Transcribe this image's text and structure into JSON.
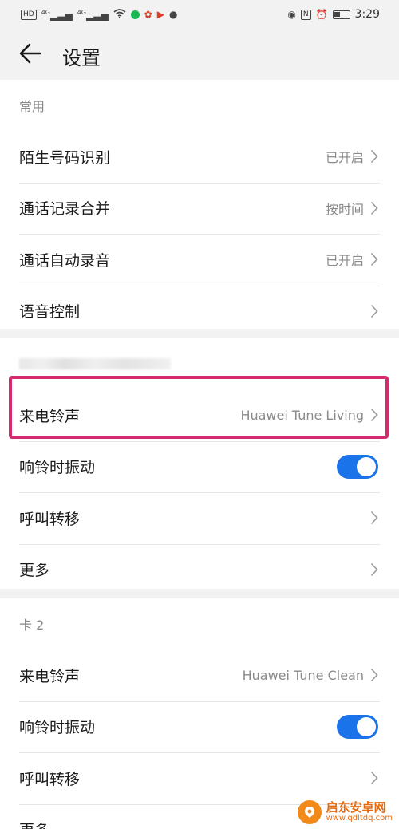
{
  "status_bar": {
    "hd_badge": "HD",
    "signal_1": "4G",
    "signal_2": "4G",
    "nfc": "N",
    "time": "3:29"
  },
  "header": {
    "title": "设置"
  },
  "section_common": {
    "label": "常用",
    "items": [
      {
        "label": "陌生号码识别",
        "value": "已开启"
      },
      {
        "label": "通话记录合并",
        "value": "按时间"
      },
      {
        "label": "通话自动录音",
        "value": "已开启"
      },
      {
        "label": "语音控制",
        "value": ""
      }
    ]
  },
  "section_card1": {
    "ringtone": {
      "label": "来电铃声",
      "value": "Huawei Tune Living"
    },
    "vibrate": {
      "label": "响铃时振动",
      "on": true
    },
    "forward": {
      "label": "呼叫转移"
    },
    "more": {
      "label": "更多"
    }
  },
  "section_card2": {
    "label": "卡 2",
    "ringtone": {
      "label": "来电铃声",
      "value": "Huawei Tune Clean"
    },
    "vibrate": {
      "label": "响铃时振动",
      "on": true
    },
    "forward": {
      "label": "呼叫转移"
    },
    "more": {
      "label": "更多"
    }
  },
  "watermark": {
    "name": "启东安卓网",
    "url": "www.qdltdq.com"
  },
  "colors": {
    "accent": "#1a73e8",
    "highlight": "#d22c6f",
    "background": "#f2f2f2"
  }
}
